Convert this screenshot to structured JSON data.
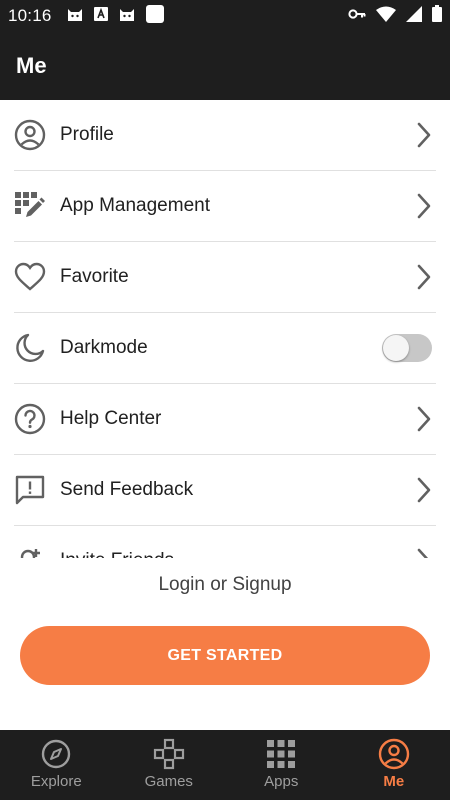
{
  "status_bar": {
    "time": "10:16",
    "left_icons": [
      "cat-notification-icon",
      "a-notification-icon",
      "cat-notification-icon",
      "blank-notification-icon"
    ],
    "right_icons": [
      "vpn-key-icon",
      "wifi-icon",
      "signal-icon",
      "battery-icon"
    ]
  },
  "app_bar": {
    "title": "Me"
  },
  "menu": {
    "items": [
      {
        "label": "Profile",
        "icon": "account-circle-icon",
        "trailing": "chevron"
      },
      {
        "label": "App Management",
        "icon": "app-management-icon",
        "trailing": "chevron"
      },
      {
        "label": "Favorite",
        "icon": "heart-icon",
        "trailing": "chevron"
      },
      {
        "label": "Darkmode",
        "icon": "moon-icon",
        "trailing": "toggle",
        "enabled": false
      },
      {
        "label": "Help Center",
        "icon": "help-circle-icon",
        "trailing": "chevron"
      },
      {
        "label": "Send Feedback",
        "icon": "feedback-icon",
        "trailing": "chevron"
      },
      {
        "label": "Invite Friends",
        "icon": "add-person-icon",
        "trailing": "chevron"
      }
    ]
  },
  "login": {
    "prompt": "Login or Signup",
    "button_label": "GET STARTED"
  },
  "bottom_nav": {
    "items": [
      {
        "label": "Explore",
        "icon": "compass-icon",
        "active": false
      },
      {
        "label": "Games",
        "icon": "gamepad-icon",
        "active": false
      },
      {
        "label": "Apps",
        "icon": "apps-grid-icon",
        "active": false
      },
      {
        "label": "Me",
        "icon": "account-circle-icon",
        "active": true
      }
    ]
  },
  "colors": {
    "accent": "#f67d45",
    "dark_bar": "#1e1e1e",
    "icon_gray": "#616161",
    "inactive_nav": "#9e9e9e"
  }
}
